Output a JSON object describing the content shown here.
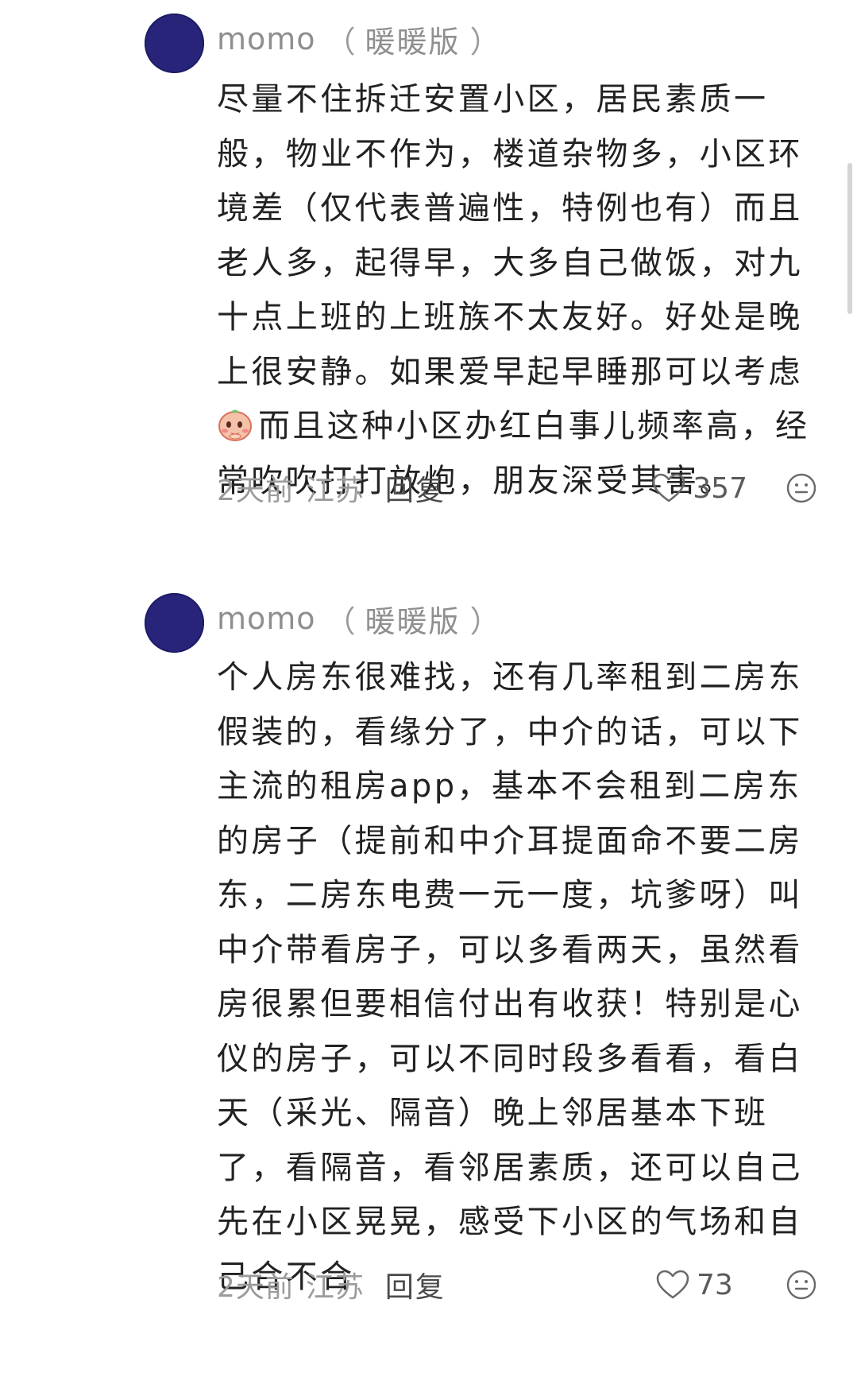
{
  "comments": [
    {
      "username": "momo",
      "nickname": "暖暖版",
      "paren_open": "（",
      "paren_close": "）",
      "lines": [
        "尽量不住拆迁安置小区，居民素质一",
        "般，物业不作为，楼道杂物多，小区环",
        "境差（仅代表普遍性，特例也有）而且",
        "老人多，起得早，大多自己做饭，对九",
        "十点上班的上班族不太友好。好处是晚",
        "上很安静。如果爱早起早睡那可以考虑",
        "而且这种小区办红白事儿频率高，经",
        "常吹吹打打放炮，朋友深受其害。"
      ],
      "inline_emoji_icon": "blushing-face-emoji",
      "time": "2天前",
      "location": "江苏",
      "reply_label": "回复",
      "like_count": "357"
    },
    {
      "username": "momo",
      "nickname": "暖暖版",
      "paren_open": "（",
      "paren_close": "）",
      "lines": [
        "个人房东很难找，还有几率租到二房东",
        "假装的，看缘分了，中介的话，可以下",
        "主流的租房app，基本不会租到二房东",
        "的房子（提前和中介耳提面命不要二房",
        "东，二房东电费一元一度，坑爹呀）叫",
        "中介带看房子，可以多看两天，虽然看",
        "房很累但要相信付出有收获！特别是心",
        "仪的房子，可以不同时段多看看，看白",
        "天（采光、隔音）晚上邻居基本下班",
        "了，看隔音，看邻居素质，还可以自己",
        "先在小区晃晃，感受下小区的气场和自",
        "己合不合"
      ],
      "time": "2天前",
      "location": "江苏",
      "reply_label": "回复",
      "like_count": "73"
    }
  ],
  "icons": {
    "like": "heart-outline-icon",
    "react": "smiley-face-icon"
  },
  "colors": {
    "avatar": "#27247a",
    "meta_text": "#9b9b9b",
    "body_text": "#222222"
  }
}
